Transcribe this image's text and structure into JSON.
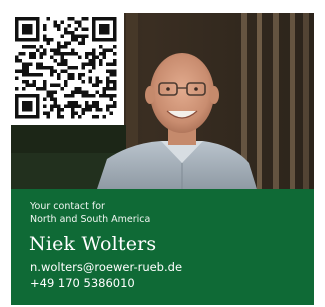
{
  "colors": {
    "panel_green": "#0f6a36",
    "text": "#ffffff"
  },
  "contact_card": {
    "intro_line_1": "Your contact for",
    "intro_line_2": "North and South America",
    "name": "Niek Wolters",
    "email": "n.wolters@roewer-rueb.de",
    "phone": "+49 170 5386010"
  },
  "icons": {
    "qr": "qr-code-icon"
  }
}
